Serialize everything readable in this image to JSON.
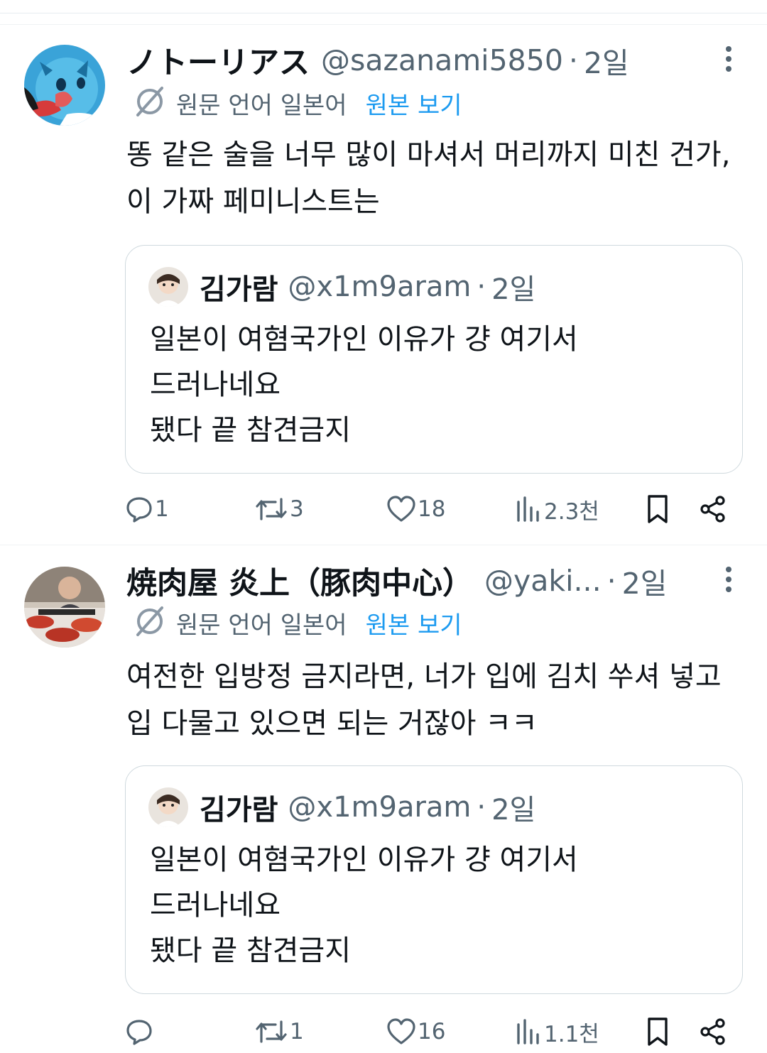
{
  "tweets": [
    {
      "display_name": "ノトーリアス",
      "handle": "@sazanami5850",
      "separator": "·",
      "time": "2일",
      "translation_note": "원문 언어 일본어",
      "view_original": "원본 보기",
      "text": "똥 같은 술을 너무 많이 마셔서 머리까지 미친 건가, 이 가짜 페미니스트는",
      "quoted": {
        "display_name": "김가람",
        "handle": "@x1m9aram",
        "separator": "·",
        "time": "2일",
        "lines": [
          "일본이 여혐국가인 이유가 걍 여기서",
          "드러나네요",
          "됐다 끝 참견금지"
        ]
      },
      "stats": {
        "replies": "1",
        "retweets": "3",
        "likes": "18",
        "views": "2.3천"
      }
    },
    {
      "display_name": "焼肉屋 炎上（豚肉中心）",
      "handle": "@yaki...",
      "separator": "·",
      "time": "2일",
      "translation_note": "원문 언어 일본어",
      "view_original": "원본 보기",
      "text": "여전한 입방정 금지라면, 너가 입에 김치 쑤셔 넣고 입 다물고 있으면 되는 거잖아 ㅋㅋ",
      "quoted": {
        "display_name": "김가람",
        "handle": "@x1m9aram",
        "separator": "·",
        "time": "2일",
        "lines": [
          "일본이 여혐국가인 이유가 걍 여기서",
          "드러나네요",
          "됐다 끝 참견금지"
        ]
      },
      "stats": {
        "replies": "",
        "retweets": "1",
        "likes": "16",
        "views": "1.1천"
      }
    }
  ],
  "colors": {
    "accent": "#1d9bf0",
    "secondary_text": "#536471",
    "border": "#cfd9de"
  }
}
